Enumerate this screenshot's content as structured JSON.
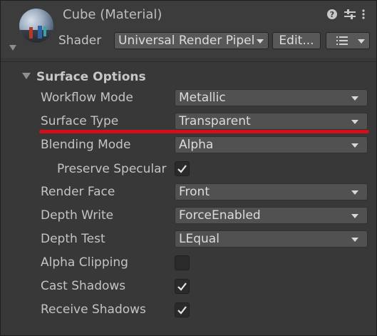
{
  "header": {
    "title": "Cube (Material)",
    "shader_label": "Shader",
    "shader_value": "Universal Render Pipeline/Lit",
    "edit_label": "Edit...",
    "help_glyph": "?",
    "icons": [
      "help-icon",
      "preset-sliders-icon",
      "more-vert-icon",
      "list-menu-icon"
    ]
  },
  "section": {
    "title": "Surface Options",
    "rows": {
      "workflow_mode": {
        "label": "Workflow Mode",
        "value": "Metallic"
      },
      "surface_type": {
        "label": "Surface Type",
        "value": "Transparent"
      },
      "blending_mode": {
        "label": "Blending Mode",
        "value": "Alpha"
      },
      "preserve_specular": {
        "label": "Preserve Specular",
        "checked": true
      },
      "render_face": {
        "label": "Render Face",
        "value": "Front"
      },
      "depth_write": {
        "label": "Depth Write",
        "value": "ForceEnabled"
      },
      "depth_test": {
        "label": "Depth Test",
        "value": "LEqual"
      },
      "alpha_clipping": {
        "label": "Alpha Clipping",
        "checked": false
      },
      "cast_shadows": {
        "label": "Cast Shadows",
        "checked": true
      },
      "receive_shadows": {
        "label": "Receive Shadows",
        "checked": true
      }
    }
  },
  "colors": {
    "background": "#383838",
    "highlight_underline": "#d3101a",
    "dropdown_bg": "#515151",
    "checkbox_bg": "#2a2a2a"
  }
}
